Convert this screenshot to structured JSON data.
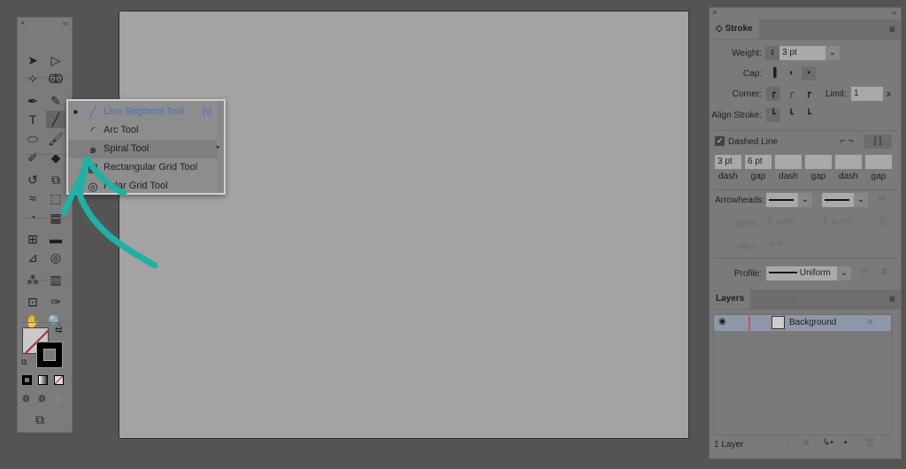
{
  "toolbar": {
    "tools": [
      {
        "name": "selection-tool",
        "glyph": "➤"
      },
      {
        "name": "direct-selection-tool",
        "glyph": "▷"
      },
      {
        "name": "magic-wand-tool",
        "glyph": "✧"
      },
      {
        "name": "lasso-tool",
        "glyph": "ↂ"
      },
      {
        "name": "pen-tool",
        "glyph": "✒"
      },
      {
        "name": "curvature-tool",
        "glyph": "✎"
      },
      {
        "name": "type-tool",
        "glyph": "T"
      },
      {
        "name": "line-segment-tool",
        "glyph": "╱"
      },
      {
        "name": "ellipse-tool",
        "glyph": "⬭"
      },
      {
        "name": "paintbrush-tool",
        "glyph": "🖌"
      },
      {
        "name": "shaper-tool",
        "glyph": "✐"
      },
      {
        "name": "eraser-tool",
        "glyph": "◆"
      },
      {
        "name": "rotate-tool",
        "glyph": "↺"
      },
      {
        "name": "scale-tool",
        "glyph": "⧉"
      },
      {
        "name": "width-tool",
        "glyph": "≈"
      },
      {
        "name": "free-transform-tool",
        "glyph": "⬚"
      },
      {
        "name": "shape-builder-tool",
        "glyph": "◔"
      },
      {
        "name": "perspective-grid-tool",
        "glyph": "▦"
      },
      {
        "name": "mesh-tool",
        "glyph": "⊞"
      },
      {
        "name": "gradient-tool",
        "glyph": "▬"
      },
      {
        "name": "eyedropper-tool",
        "glyph": "⊿"
      },
      {
        "name": "blend-tool",
        "glyph": "◎"
      },
      {
        "name": "symbol-sprayer-tool",
        "glyph": "⁂"
      },
      {
        "name": "column-graph-tool",
        "glyph": "▥"
      },
      {
        "name": "artboard-tool",
        "glyph": "⊡"
      },
      {
        "name": "slice-tool",
        "glyph": "✑"
      },
      {
        "name": "hand-tool",
        "glyph": "✋"
      },
      {
        "name": "zoom-tool",
        "glyph": "🔍"
      }
    ]
  },
  "flyout": {
    "items": [
      {
        "label": "Line Segment Tool",
        "shortcut": "(\\)",
        "icon": "╱",
        "active": true
      },
      {
        "label": "Arc Tool",
        "icon": "◜"
      },
      {
        "label": "Spiral Tool",
        "icon": "๑",
        "hover": true
      },
      {
        "label": "Rectangular Grid Tool",
        "icon": "▦"
      },
      {
        "label": "Polar Grid Tool",
        "icon": "◎"
      }
    ],
    "active_color": "#3b74c9"
  },
  "stroke": {
    "tab": "Stroke",
    "weight_label": "Weight:",
    "weight": "3 pt",
    "cap_label": "Cap:",
    "corner_label": "Corner:",
    "limit_label": "Limit:",
    "limit": "1",
    "limit_unit": "x",
    "align_label": "Align Stroke:",
    "dashed_label": "Dashed Line",
    "dashed_checked": true,
    "dash_fields": [
      {
        "value": "3 pt",
        "label": "dash"
      },
      {
        "value": "6 pt",
        "label": "gap"
      },
      {
        "value": "",
        "label": "dash"
      },
      {
        "value": "",
        "label": "gap"
      },
      {
        "value": "",
        "label": "dash"
      },
      {
        "value": "",
        "label": "gap"
      }
    ],
    "arrowheads_label": "Arrowheads:",
    "scale_label": "Scale:",
    "scale_start": "100%",
    "scale_end": "100%",
    "align_arrow_label": "Align:",
    "profile_label": "Profile:",
    "profile": "Uniform"
  },
  "layers": {
    "tabs": [
      "Layers",
      "Artboards"
    ],
    "rows": [
      {
        "name": "Background",
        "color": "#e0474c"
      }
    ],
    "count": "1 Layer"
  },
  "annotation": {
    "arrow_color": "#1fb0a6"
  }
}
